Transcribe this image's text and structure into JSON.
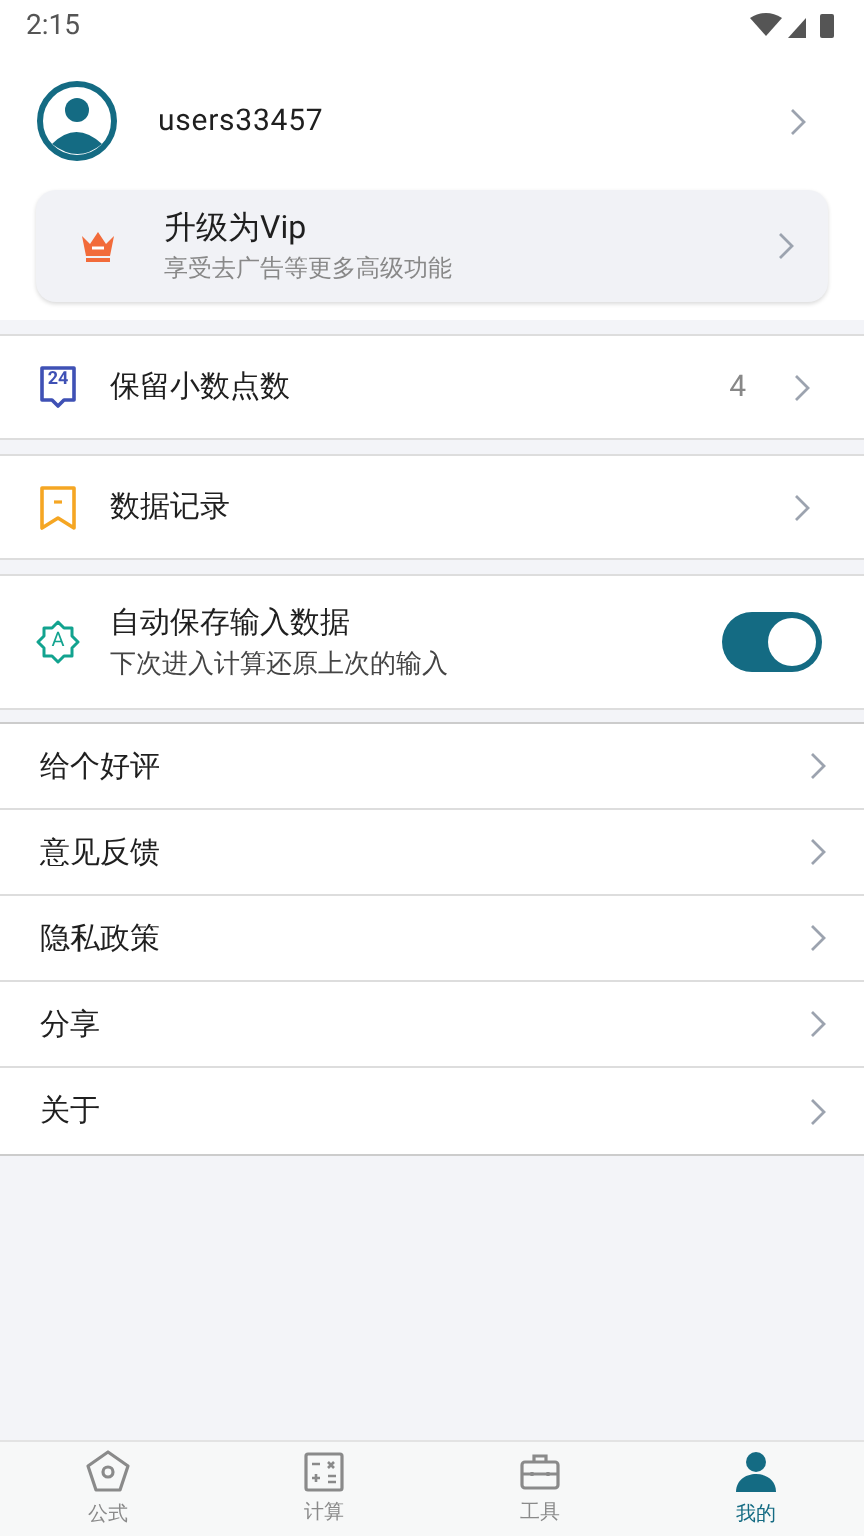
{
  "status_bar": {
    "time": "2:15"
  },
  "profile": {
    "username": "users33457"
  },
  "vip": {
    "title": "升级为Vip",
    "subtitle": "享受去广告等更多高级功能"
  },
  "settings": [
    {
      "kind": "value",
      "icon_text": "24",
      "label": "保留小数点数",
      "value": "4"
    },
    {
      "kind": "link",
      "label": "数据记录"
    },
    {
      "kind": "toggle",
      "icon_text": "A",
      "label": "自动保存输入数据",
      "subtitle": "下次进入计算还原上次的输入",
      "on": true
    }
  ],
  "menu": [
    "给个好评",
    "意见反馈",
    "隐私政策",
    "分享",
    "关于"
  ],
  "tabs": [
    {
      "label": "公式",
      "selected": false
    },
    {
      "label": "计算",
      "selected": false
    },
    {
      "label": "工具",
      "selected": false
    },
    {
      "label": "我的",
      "selected": true
    }
  ]
}
